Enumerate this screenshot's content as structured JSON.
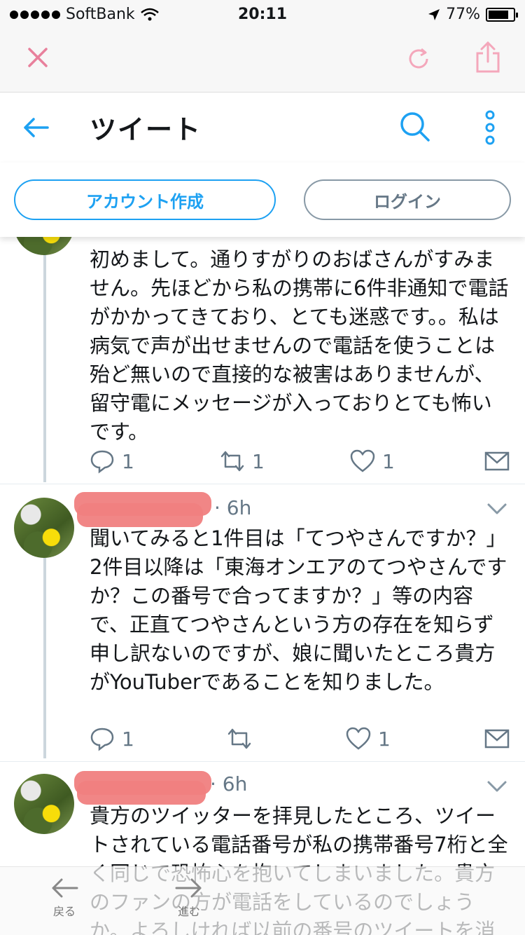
{
  "status_bar": {
    "carrier": "SoftBank",
    "time": "20:11",
    "battery": "77%",
    "battery_level": 0.77
  },
  "header": {
    "title": "ツイート"
  },
  "auth": {
    "signup_label": "アカウント作成",
    "login_label": "ログイン"
  },
  "tweets": [
    {
      "text": "初めまして。通りすがりのおばさんがすみません。先ほどから私の携帯に6件非通知で電話がかかってきており、とても迷惑です。。私は病気で声が出せませんので電話を使うことは殆ど無いので直接的な被害はありませんが、留守電にメッセージが入っておりとても怖いです。",
      "replies": "1",
      "retweets": "1",
      "likes": "1"
    },
    {
      "time": "· 6h",
      "text": "聞いてみると1件目は「てつやさんですか？」2件目以降は「東海オンエアのてつやさんですか？この番号で合ってますか？」等の内容で、正直てつやさんという方の存在を知らず申し訳ないのですが、娘に聞いたところ貴方がYouTuberであることを知りました。",
      "replies": "1",
      "retweets": "",
      "likes": "1"
    },
    {
      "time": "· 6h",
      "text": "貴方のツイッターを拝見したところ、ツイートされている電話番号が私の携帯番号7桁と全く同じで恐怖心を抱いてしまいました。貴方のファンの方が電話をしているのでしょうか。よろしければ以前の番号のツイートを消"
    }
  ],
  "toolbar": {
    "back_label": "戻る",
    "forward_label": "進む"
  },
  "colors": {
    "accent": "#1da1f2",
    "muted": "#657786",
    "close_pink": "#e0245e",
    "redaction": "#f08080"
  }
}
